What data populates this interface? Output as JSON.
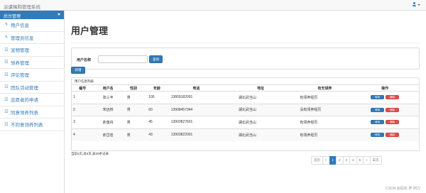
{
  "app": {
    "brand": "派遣赐购管理系统"
  },
  "sidebar": {
    "header": "后台管理",
    "items": [
      {
        "label": "用户信息",
        "icon": "bolt-icon",
        "glyph": "ϟ"
      },
      {
        "label": "管理员信息",
        "icon": "bolt-icon",
        "glyph": "ϟ"
      },
      {
        "label": "宠物管理",
        "icon": "sitemap-icon",
        "glyph": "☷"
      },
      {
        "label": "领养管理",
        "icon": "sitemap-icon",
        "glyph": "☷"
      },
      {
        "label": "评论管理",
        "icon": "sitemap-icon",
        "glyph": "☷"
      },
      {
        "label": "团队活动管理",
        "icon": "sitemap-icon",
        "glyph": "☷"
      },
      {
        "label": "志愿者的申请",
        "icon": "sitemap-icon",
        "glyph": "☷"
      },
      {
        "label": "同意领养列表",
        "icon": "sitemap-icon",
        "glyph": "☷"
      },
      {
        "label": "不同意领养列表",
        "icon": "sitemap-icon",
        "glyph": "☷"
      }
    ]
  },
  "main": {
    "title": "用户管理",
    "search": {
      "label": "用户名称",
      "value": "",
      "button": "查询"
    },
    "add_button": "新增",
    "table": {
      "caption": "用户信息列表",
      "headers": [
        "编号",
        "用户名",
        "性别",
        "年龄",
        "电话",
        "地址",
        "有无领养",
        "操作"
      ],
      "edit_label": "修改",
      "delete_label": "删除",
      "rows": [
        {
          "id": "1",
          "name": "张三丰",
          "gender": "男",
          "age": "100",
          "phone": "13809182091",
          "address": "湖北武当山",
          "adopt": "有领养经历"
        },
        {
          "id": "2",
          "name": "宋远桥",
          "gender": "男",
          "age": "60",
          "phone": "13908457344",
          "address": "湖北武当山",
          "adopt": "没有领养经历"
        },
        {
          "id": "3",
          "name": "俞莲舟",
          "gender": "男",
          "age": "45",
          "phone": "13903827601",
          "address": "湖北武当山",
          "adopt": "有领养经历"
        },
        {
          "id": "4",
          "name": "俞岱岩",
          "gender": "男",
          "age": "43",
          "phone": "13903822001",
          "address": "湖北武当山",
          "adopt": "有领养经历"
        }
      ]
    },
    "footer": "当前1页,总5页,总20条记录",
    "pagination": {
      "first": "首页",
      "prev": "«",
      "pages": [
        "1",
        "2",
        "3",
        "4",
        "5"
      ],
      "next": "»",
      "last": "末页",
      "active": "1"
    }
  },
  "watermark": "CSDN @码农·罗·阿力",
  "colors": {
    "primary": "#337ab7",
    "danger": "#d9534f"
  }
}
